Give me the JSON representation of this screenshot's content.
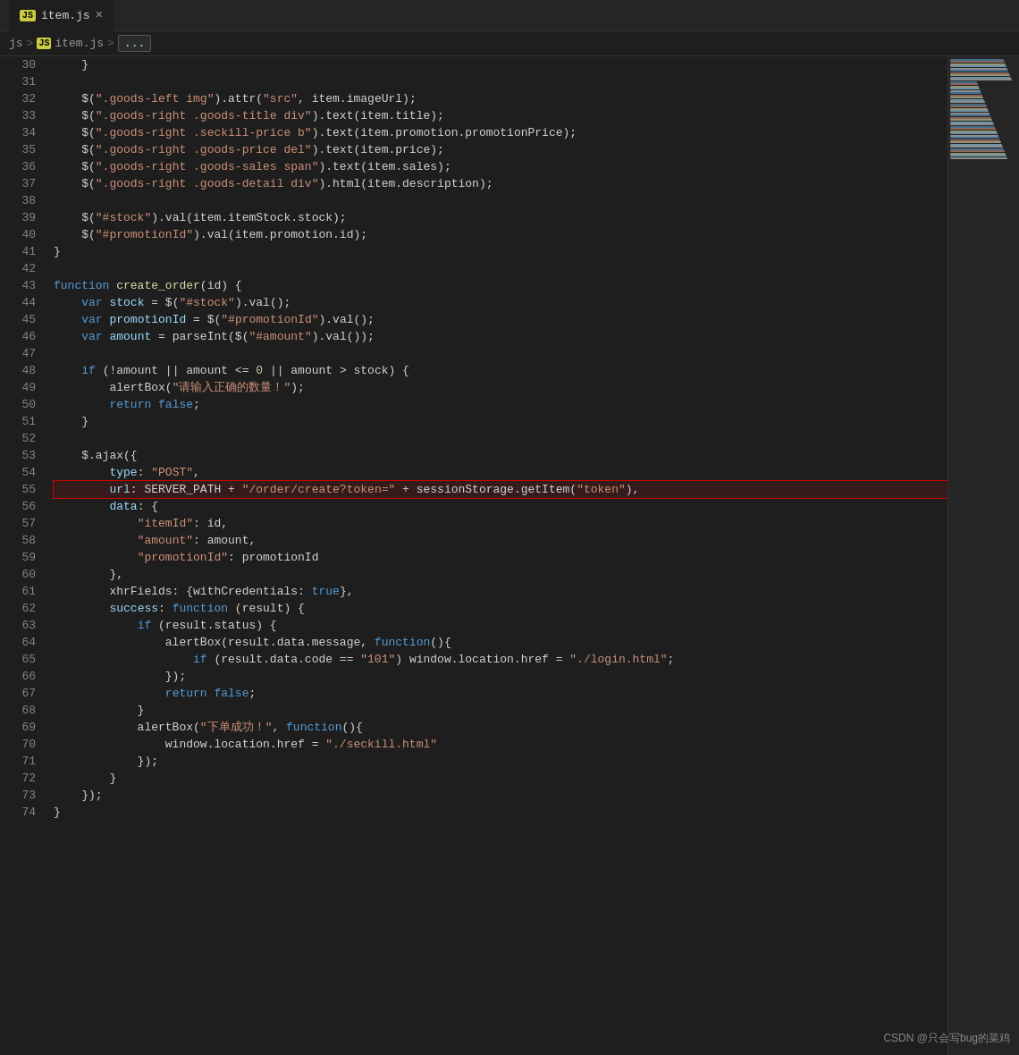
{
  "titleBar": {
    "jsIconLabel": "JS",
    "tabName": "item.js",
    "closeIcon": "×"
  },
  "breadcrumb": {
    "parts": [
      "js",
      ">",
      "JS item.js",
      ">",
      "..."
    ]
  },
  "lines": [
    {
      "num": 30,
      "tokens": [
        {
          "t": "    }",
          "c": "plain"
        }
      ]
    },
    {
      "num": 31,
      "tokens": []
    },
    {
      "num": 32,
      "tokens": [
        {
          "t": "    $(",
          "c": "plain"
        },
        {
          "t": "\".goods-left img\"",
          "c": "str"
        },
        {
          "t": ").attr(",
          "c": "plain"
        },
        {
          "t": "\"src\"",
          "c": "str"
        },
        {
          "t": ", item.imageUrl);",
          "c": "plain"
        }
      ]
    },
    {
      "num": 33,
      "tokens": [
        {
          "t": "    $(",
          "c": "plain"
        },
        {
          "t": "\".goods-right .goods-title div\"",
          "c": "str"
        },
        {
          "t": ").text(item.title);",
          "c": "plain"
        }
      ]
    },
    {
      "num": 34,
      "tokens": [
        {
          "t": "    $(",
          "c": "plain"
        },
        {
          "t": "\".goods-right .seckill-price b\"",
          "c": "str"
        },
        {
          "t": ").text(item.promotion.promotionPrice);",
          "c": "plain"
        }
      ]
    },
    {
      "num": 35,
      "tokens": [
        {
          "t": "    $(",
          "c": "plain"
        },
        {
          "t": "\".goods-right .goods-price del\"",
          "c": "str"
        },
        {
          "t": ").text(item.price);",
          "c": "plain"
        }
      ]
    },
    {
      "num": 36,
      "tokens": [
        {
          "t": "    $(",
          "c": "plain"
        },
        {
          "t": "\".goods-right .goods-sales span\"",
          "c": "str"
        },
        {
          "t": ").text(item.sales);",
          "c": "plain"
        }
      ]
    },
    {
      "num": 37,
      "tokens": [
        {
          "t": "    $(",
          "c": "plain"
        },
        {
          "t": "\".goods-right .goods-detail div\"",
          "c": "str"
        },
        {
          "t": ").html(item.description);",
          "c": "plain"
        }
      ]
    },
    {
      "num": 38,
      "tokens": []
    },
    {
      "num": 39,
      "tokens": [
        {
          "t": "    $(",
          "c": "plain"
        },
        {
          "t": "\"#stock\"",
          "c": "str"
        },
        {
          "t": ").val(item.itemStock.stock);",
          "c": "plain"
        }
      ]
    },
    {
      "num": 40,
      "tokens": [
        {
          "t": "    $(",
          "c": "plain"
        },
        {
          "t": "\"#promotionId\"",
          "c": "str"
        },
        {
          "t": ").val(item.promotion.id);",
          "c": "plain"
        }
      ]
    },
    {
      "num": 41,
      "tokens": [
        {
          "t": "}",
          "c": "plain"
        }
      ]
    },
    {
      "num": 42,
      "tokens": []
    },
    {
      "num": 43,
      "tokens": [
        {
          "t": "function ",
          "c": "kw"
        },
        {
          "t": "create_order",
          "c": "fn"
        },
        {
          "t": "(id) {",
          "c": "plain"
        }
      ]
    },
    {
      "num": 44,
      "tokens": [
        {
          "t": "    ",
          "c": "plain"
        },
        {
          "t": "var ",
          "c": "kw"
        },
        {
          "t": "stock",
          "c": "var-name"
        },
        {
          "t": " = $(",
          "c": "plain"
        },
        {
          "t": "\"#stock\"",
          "c": "str"
        },
        {
          "t": ").val();",
          "c": "plain"
        }
      ]
    },
    {
      "num": 45,
      "tokens": [
        {
          "t": "    ",
          "c": "plain"
        },
        {
          "t": "var ",
          "c": "kw"
        },
        {
          "t": "promotionId",
          "c": "var-name"
        },
        {
          "t": " = $(",
          "c": "plain"
        },
        {
          "t": "\"#promotionId\"",
          "c": "str"
        },
        {
          "t": ").val();",
          "c": "plain"
        }
      ]
    },
    {
      "num": 46,
      "tokens": [
        {
          "t": "    ",
          "c": "plain"
        },
        {
          "t": "var ",
          "c": "kw"
        },
        {
          "t": "amount",
          "c": "var-name"
        },
        {
          "t": " = parseInt($(",
          "c": "plain"
        },
        {
          "t": "\"#amount\"",
          "c": "str"
        },
        {
          "t": ").val());",
          "c": "plain"
        }
      ]
    },
    {
      "num": 47,
      "tokens": []
    },
    {
      "num": 48,
      "tokens": [
        {
          "t": "    ",
          "c": "plain"
        },
        {
          "t": "if ",
          "c": "kw"
        },
        {
          "t": "(!amount || amount <= ",
          "c": "plain"
        },
        {
          "t": "0",
          "c": "num"
        },
        {
          "t": " || amount > stock) {",
          "c": "plain"
        }
      ]
    },
    {
      "num": 49,
      "tokens": [
        {
          "t": "        alertBox(",
          "c": "plain"
        },
        {
          "t": "\"请输入正确的数量！\"",
          "c": "str"
        },
        {
          "t": ");",
          "c": "plain"
        }
      ]
    },
    {
      "num": 50,
      "tokens": [
        {
          "t": "        ",
          "c": "plain"
        },
        {
          "t": "return ",
          "c": "kw"
        },
        {
          "t": "false",
          "c": "kw"
        },
        {
          "t": ";",
          "c": "plain"
        }
      ]
    },
    {
      "num": 51,
      "tokens": [
        {
          "t": "    }",
          "c": "plain"
        }
      ]
    },
    {
      "num": 52,
      "tokens": []
    },
    {
      "num": 53,
      "tokens": [
        {
          "t": "    $.ajax({",
          "c": "plain"
        }
      ]
    },
    {
      "num": 54,
      "tokens": [
        {
          "t": "        ",
          "c": "plain"
        },
        {
          "t": "type",
          "c": "prop"
        },
        {
          "t": ": ",
          "c": "plain"
        },
        {
          "t": "\"POST\"",
          "c": "str"
        },
        {
          "t": ",",
          "c": "plain"
        }
      ]
    },
    {
      "num": 55,
      "tokens": [
        {
          "t": "        ",
          "c": "plain"
        },
        {
          "t": "url",
          "c": "prop"
        },
        {
          "t": ": SERVER_PATH + ",
          "c": "plain"
        },
        {
          "t": "\"/order/create?token=\"",
          "c": "str"
        },
        {
          "t": " + sessionStorage.getItem(",
          "c": "plain"
        },
        {
          "t": "\"token\"",
          "c": "str"
        },
        {
          "t": "),",
          "c": "plain"
        }
      ],
      "highlighted": true
    },
    {
      "num": 56,
      "tokens": [
        {
          "t": "        ",
          "c": "plain"
        },
        {
          "t": "data",
          "c": "prop"
        },
        {
          "t": ": {",
          "c": "plain"
        }
      ]
    },
    {
      "num": 57,
      "tokens": [
        {
          "t": "            ",
          "c": "plain"
        },
        {
          "t": "\"itemId\"",
          "c": "str"
        },
        {
          "t": ": id,",
          "c": "plain"
        }
      ]
    },
    {
      "num": 58,
      "tokens": [
        {
          "t": "            ",
          "c": "plain"
        },
        {
          "t": "\"amount\"",
          "c": "str"
        },
        {
          "t": ": amount,",
          "c": "plain"
        }
      ]
    },
    {
      "num": 59,
      "tokens": [
        {
          "t": "            ",
          "c": "plain"
        },
        {
          "t": "\"promotionId\"",
          "c": "str"
        },
        {
          "t": ": promotionId",
          "c": "plain"
        }
      ]
    },
    {
      "num": 60,
      "tokens": [
        {
          "t": "        },",
          "c": "plain"
        }
      ]
    },
    {
      "num": 61,
      "tokens": [
        {
          "t": "        xhrFields: {withCredentials: ",
          "c": "plain"
        },
        {
          "t": "true",
          "c": "kw"
        },
        {
          "t": "},",
          "c": "plain"
        }
      ]
    },
    {
      "num": 62,
      "tokens": [
        {
          "t": "        ",
          "c": "plain"
        },
        {
          "t": "success",
          "c": "prop"
        },
        {
          "t": ": ",
          "c": "plain"
        },
        {
          "t": "function ",
          "c": "kw"
        },
        {
          "t": "(result) {",
          "c": "plain"
        }
      ]
    },
    {
      "num": 63,
      "tokens": [
        {
          "t": "            ",
          "c": "plain"
        },
        {
          "t": "if ",
          "c": "kw"
        },
        {
          "t": "(result.status) {",
          "c": "plain"
        }
      ]
    },
    {
      "num": 64,
      "tokens": [
        {
          "t": "                alertBox(result.data.message, ",
          "c": "plain"
        },
        {
          "t": "function",
          "c": "kw"
        },
        {
          "t": "(){",
          "c": "plain"
        }
      ]
    },
    {
      "num": 65,
      "tokens": [
        {
          "t": "                    ",
          "c": "plain"
        },
        {
          "t": "if ",
          "c": "kw"
        },
        {
          "t": "(result.data.code == ",
          "c": "plain"
        },
        {
          "t": "\"101\"",
          "c": "str"
        },
        {
          "t": ") window.location.href = ",
          "c": "plain"
        },
        {
          "t": "\"./login.html\"",
          "c": "str"
        },
        {
          "t": ";",
          "c": "plain"
        }
      ]
    },
    {
      "num": 66,
      "tokens": [
        {
          "t": "                });",
          "c": "plain"
        }
      ]
    },
    {
      "num": 67,
      "tokens": [
        {
          "t": "                ",
          "c": "plain"
        },
        {
          "t": "return ",
          "c": "kw"
        },
        {
          "t": "false",
          "c": "kw"
        },
        {
          "t": ";",
          "c": "plain"
        }
      ]
    },
    {
      "num": 68,
      "tokens": [
        {
          "t": "            }",
          "c": "plain"
        }
      ]
    },
    {
      "num": 69,
      "tokens": [
        {
          "t": "            alertBox(",
          "c": "plain"
        },
        {
          "t": "\"下单成功！\"",
          "c": "str"
        },
        {
          "t": ", ",
          "c": "plain"
        },
        {
          "t": "function",
          "c": "kw"
        },
        {
          "t": "(){",
          "c": "plain"
        }
      ]
    },
    {
      "num": 70,
      "tokens": [
        {
          "t": "                window.location.href = ",
          "c": "plain"
        },
        {
          "t": "\"./seckill.html\"",
          "c": "str"
        }
      ]
    },
    {
      "num": 71,
      "tokens": [
        {
          "t": "            });",
          "c": "plain"
        }
      ]
    },
    {
      "num": 72,
      "tokens": [
        {
          "t": "        }",
          "c": "plain"
        }
      ]
    },
    {
      "num": 73,
      "tokens": [
        {
          "t": "    });",
          "c": "plain"
        }
      ]
    },
    {
      "num": 74,
      "tokens": [
        {
          "t": "}",
          "c": "plain"
        }
      ]
    }
  ],
  "watermark": "CSDN @只会写bug的菜鸡"
}
